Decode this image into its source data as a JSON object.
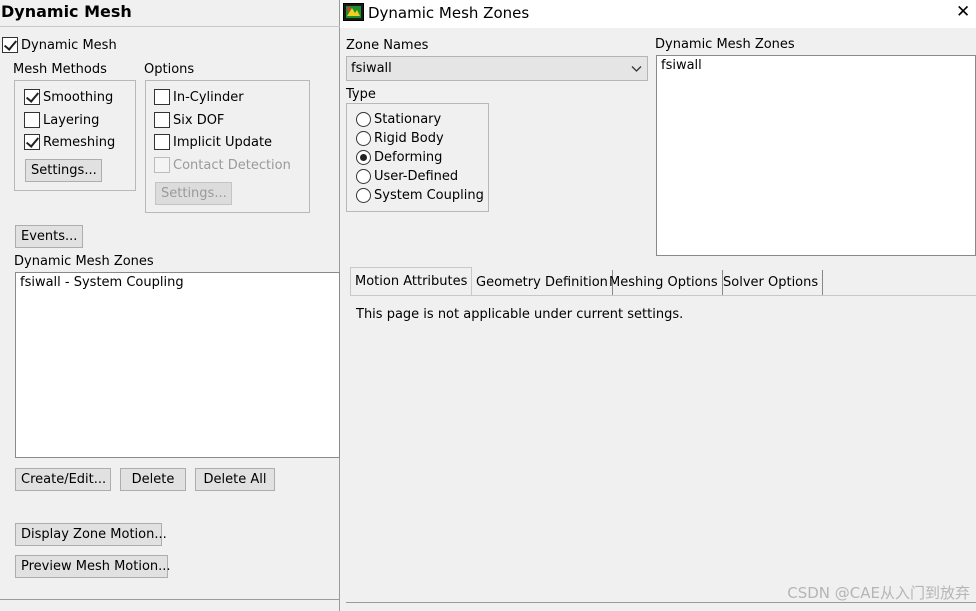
{
  "left_panel": {
    "title": "Dynamic Mesh",
    "dynamic_mesh_label": "Dynamic Mesh",
    "mesh_methods": {
      "label": "Mesh Methods",
      "smoothing": "Smoothing",
      "layering": "Layering",
      "remeshing": "Remeshing",
      "settings_button": "Settings..."
    },
    "options": {
      "label": "Options",
      "in_cylinder": "In-Cylinder",
      "six_dof": "Six DOF",
      "implicit_update": "Implicit Update",
      "contact_detection": "Contact Detection",
      "settings_button": "Settings..."
    },
    "events_button": "Events...",
    "zones": {
      "label": "Dynamic Mesh Zones",
      "items": [
        "fsiwall - System Coupling"
      ]
    },
    "create_edit_button": "Create/Edit...",
    "delete_button": "Delete",
    "delete_all_button": "Delete All",
    "display_zone_motion_button": "Display Zone Motion...",
    "preview_mesh_motion_button": "Preview Mesh Motion..."
  },
  "dialog": {
    "title": "Dynamic Mesh Zones",
    "close_glyph": "✕",
    "zone_names_label": "Zone Names",
    "zone_name_value": "fsiwall",
    "type_label": "Type",
    "types": [
      "Stationary",
      "Rigid Body",
      "Deforming",
      "User-Defined",
      "System Coupling"
    ],
    "zones_list_label": "Dynamic Mesh Zones",
    "zones_list_items": [
      "fsiwall"
    ],
    "tabs": [
      "Motion Attributes",
      "Geometry Definition",
      "Meshing Options",
      "Solver Options"
    ],
    "tab_message": "This page is not applicable under current settings."
  },
  "watermark": "CSDN @CAE从入门到放弃",
  "colors": {
    "window_bg": "#f0f0f0",
    "titlebar_bg": "#ffffff",
    "button_bg": "#e1e1e1"
  }
}
